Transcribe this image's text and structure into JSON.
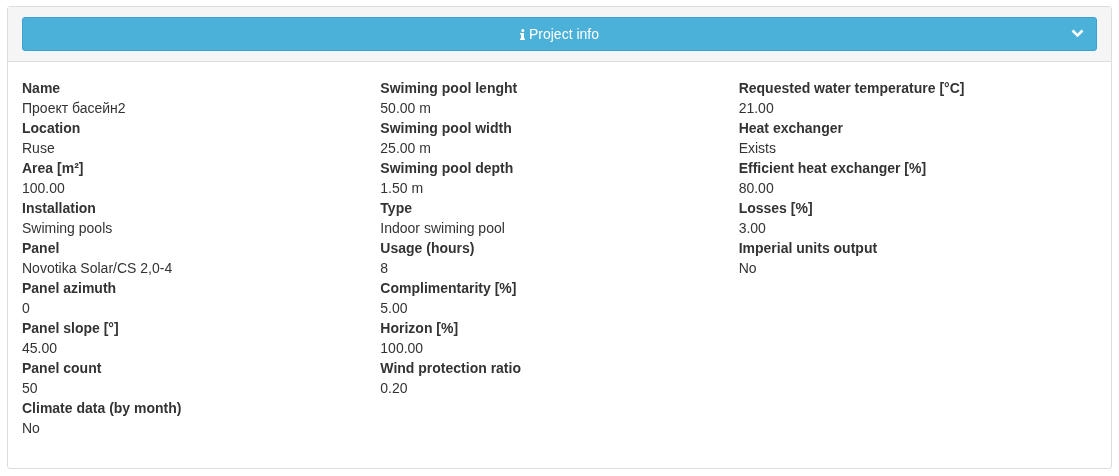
{
  "panel": {
    "title": "Project info",
    "expanded": true
  },
  "columns": [
    [
      {
        "label": "Name",
        "value": "Проект басейн2"
      },
      {
        "label": "Location",
        "value": "Ruse"
      },
      {
        "label": "Area [m²]",
        "value": "100.00"
      },
      {
        "label": "Installation",
        "value": "Swiming pools"
      },
      {
        "label": "Panel",
        "value": "Novotika Solar/CS 2,0-4"
      },
      {
        "label": "Panel azimuth",
        "value": "0"
      },
      {
        "label": "Panel slope [°]",
        "value": "45.00"
      },
      {
        "label": "Panel count",
        "value": "50"
      },
      {
        "label": "Climate data (by month)",
        "value": "No"
      }
    ],
    [
      {
        "label": "Swiming pool lenght",
        "value": "50.00 m"
      },
      {
        "label": "Swiming pool width",
        "value": "25.00 m"
      },
      {
        "label": "Swiming pool depth",
        "value": "1.50 m"
      },
      {
        "label": "Type",
        "value": "Indoor swiming pool"
      },
      {
        "label": "Usage (hours)",
        "value": "8"
      },
      {
        "label": "Complimentarity [%]",
        "value": "5.00"
      },
      {
        "label": "Horizon [%]",
        "value": "100.00"
      },
      {
        "label": "Wind protection ratio",
        "value": "0.20"
      }
    ],
    [
      {
        "label": "Requested water temperature [°C]",
        "value": "21.00"
      },
      {
        "label": "Heat exchanger",
        "value": "Exists"
      },
      {
        "label": "Efficient heat exchanger [%]",
        "value": "80.00"
      },
      {
        "label": "Losses [%]",
        "value": "3.00"
      },
      {
        "label": "Imperial units output",
        "value": "No"
      }
    ]
  ]
}
